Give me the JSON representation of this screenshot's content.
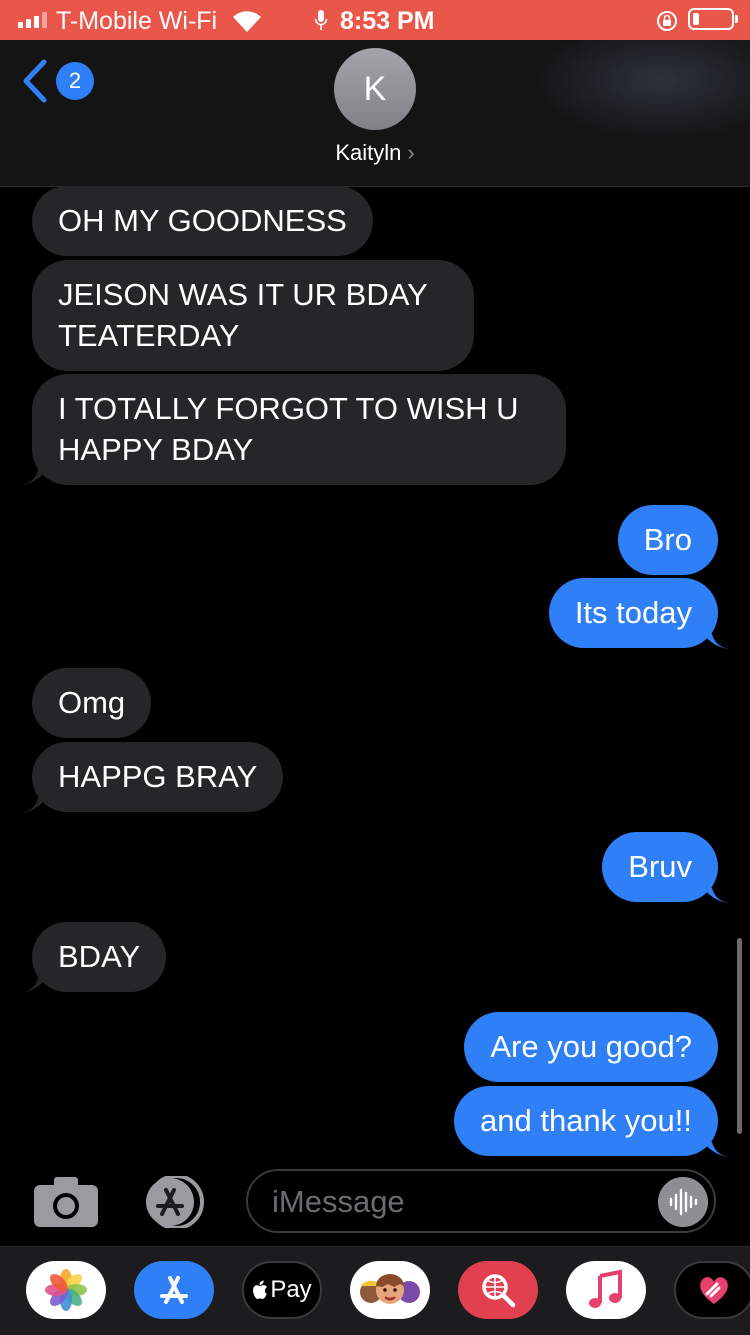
{
  "status_bar": {
    "carrier": "T-Mobile Wi-Fi",
    "time": "8:53 PM",
    "color": "#e9574a"
  },
  "header": {
    "back_count": "2",
    "avatar_initial": "K",
    "contact_name": "Kaityln",
    "chevron": "›"
  },
  "messages": [
    {
      "from": "them",
      "text": "OH MY GOODNESS"
    },
    {
      "from": "them",
      "text": "JEISON WAS IT UR BDAY TEATERDAY"
    },
    {
      "from": "them",
      "text": "I TOTALLY FORGOT TO WISH U HAPPY BDAY"
    },
    {
      "from": "me",
      "text": "Bro"
    },
    {
      "from": "me",
      "text": "Its today"
    },
    {
      "from": "them",
      "text": "Omg"
    },
    {
      "from": "them",
      "text": "HAPPG BRAY"
    },
    {
      "from": "me",
      "text": "Bruv"
    },
    {
      "from": "them",
      "text": "BDAY"
    },
    {
      "from": "me",
      "text": "Are you good?"
    },
    {
      "from": "me",
      "text": "and thank you!!"
    }
  ],
  "input": {
    "placeholder": "iMessage"
  },
  "app_drawer": {
    "apps": [
      "photos-icon",
      "app-store-icon",
      "apple-pay-icon",
      "memoji-icon",
      "web-search-icon",
      "music-icon",
      "digital-touch-icon"
    ],
    "apple_pay_label": "Pay"
  },
  "colors": {
    "sent": "#2f7ff6",
    "received": "#262628",
    "background": "#000000"
  }
}
